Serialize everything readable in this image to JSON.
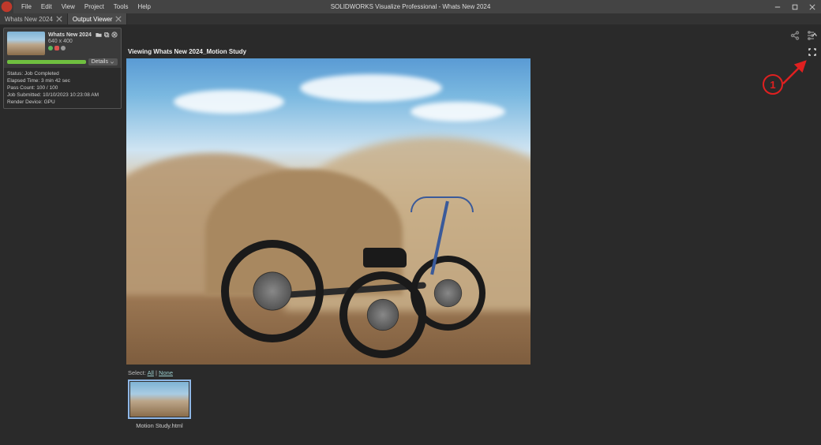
{
  "titlebar": {
    "app_title": "SOLIDWORKS Visualize Professional - Whats New 2024",
    "menu": [
      "File",
      "Edit",
      "View",
      "Project",
      "Tools",
      "Help"
    ]
  },
  "tabs": [
    {
      "label": "Whats New 2024",
      "active": false
    },
    {
      "label": "Output Viewer",
      "active": true
    }
  ],
  "job": {
    "title": "Whats New 2024",
    "dimensions": "640 x 400",
    "details_label": "Details",
    "meta": {
      "status": "Status: Job Completed",
      "elapsed": "Elapsed Time: 3 min 42 sec",
      "pass": "Pass Count: 100 / 100",
      "submitted": "Job Submitted: 10/10/2023 10:23:08 AM",
      "device": "Render Device: GPU"
    }
  },
  "viewer": {
    "heading": "Viewing Whats New 2024_Motion Study"
  },
  "select": {
    "prefix": "Select: ",
    "all": "All",
    "sep": " | ",
    "none": "None"
  },
  "thumb": {
    "label": "Motion Study.html"
  },
  "annotation": {
    "number": "1"
  }
}
